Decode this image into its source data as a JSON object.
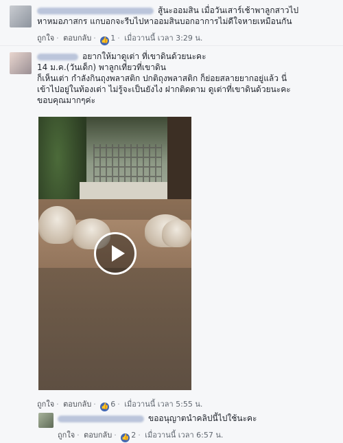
{
  "comments": [
    {
      "text_lines": [
        "สู้นะออมสิน เมื่อวันเสาร์เช้าพาลูกสาวไป",
        "หาหมอภาสกร แกบอกจะรีบไปหาออมสินบอกอาการไม่ดีใจหายเหมือนกัน"
      ],
      "actions": {
        "like": "ถูกใจ",
        "reply": "ตอบกลับ",
        "reaction_count": "1",
        "timestamp": "เมื่อวานนี้ เวลา 3:29 น."
      }
    },
    {
      "text_lines": [
        "อยากให้มาดูเต่า ที่เขาดินด้วยนะคะ",
        "14 ม.ค.(วันเด็ก) พาลูกเที่ยวที่เขาดิน",
        "ก็เห็นเต่า กำลังกินถุงพลาสติก ปกติถุงพลาสติก ก็ย่อยสลายยากอยู่แล้ว นี่",
        "เข้าไปอยู่ในท้องเต่า ไม่รู้จะเป็นยังไง ฝากติดตาม ดูเต่าที่เขาดินด้วยนะคะ",
        "ขอบคุณมากๆค่ะ"
      ],
      "actions": {
        "like": "ถูกใจ",
        "reply": "ตอบกลับ",
        "reaction_count": "6",
        "timestamp": "เมื่อวานนี้ เวลา 5:55 น."
      }
    },
    {
      "text_lines": [
        "ขออนุญาตนำคลิปนี้ไปใช้นะคะ"
      ],
      "actions": {
        "like": "ถูกใจ",
        "reply": "ตอบกลับ",
        "reaction_count": "2",
        "timestamp": "เมื่อวานนี้ เวลา 6:57 น."
      }
    }
  ],
  "icons": {
    "like_badge": "thumbs-up-icon",
    "video_play": "play-icon"
  },
  "colors": {
    "link_blue": "#365899",
    "like_blue": "#4267b2",
    "background": "#f6f7f9"
  }
}
